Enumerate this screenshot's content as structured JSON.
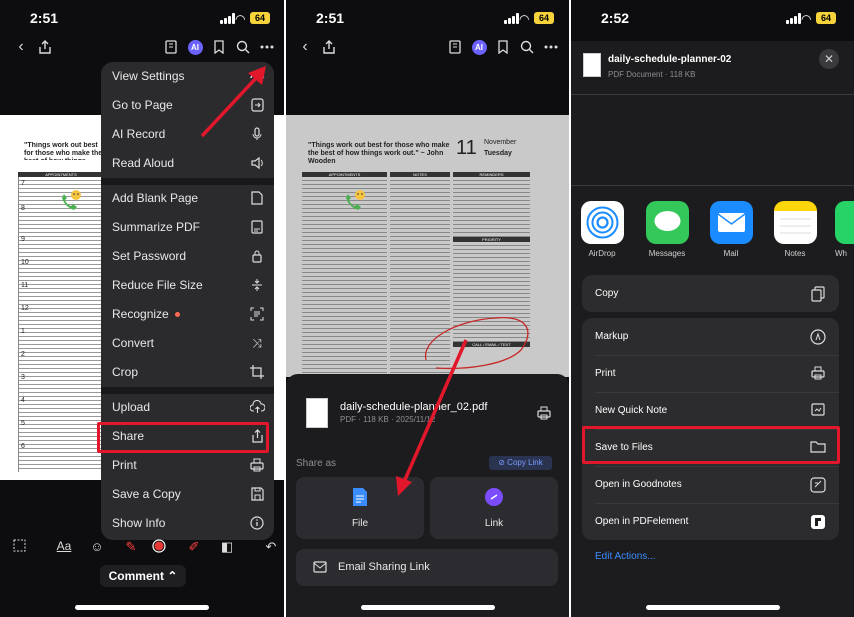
{
  "panel1": {
    "time": "2:51",
    "battery": "64",
    "document": {
      "quote": "\"Things work out best for those who make the best of how things work out.\" ~ John Wooden",
      "appointments_header": "APPOINTMENTS",
      "hours": [
        "7",
        "8",
        "9",
        "10",
        "11",
        "12",
        "1",
        "2",
        "3",
        "4",
        "5",
        "6"
      ]
    },
    "menu": {
      "items": [
        {
          "label": "View Settings",
          "icon": "text-size-icon"
        },
        {
          "label": "Go to Page",
          "icon": "goto-page-icon"
        },
        {
          "label": "AI Record",
          "icon": "microphone-icon"
        },
        {
          "label": "Read Aloud",
          "icon": "speaker-icon"
        },
        {
          "label": "Add Blank Page",
          "icon": "blank-page-icon"
        },
        {
          "label": "Summarize PDF",
          "icon": "summarize-icon"
        },
        {
          "label": "Set Password",
          "icon": "lock-icon"
        },
        {
          "label": "Reduce File Size",
          "icon": "compress-icon"
        },
        {
          "label": "Recognize",
          "icon": "ocr-icon"
        },
        {
          "label": "Convert",
          "icon": "shuffle-icon"
        },
        {
          "label": "Crop",
          "icon": "crop-icon"
        },
        {
          "label": "Upload",
          "icon": "cloud-upload-icon"
        },
        {
          "label": "Share",
          "icon": "share-icon"
        },
        {
          "label": "Print",
          "icon": "printer-icon"
        },
        {
          "label": "Save a Copy",
          "icon": "save-icon"
        },
        {
          "label": "Show Info",
          "icon": "info-icon"
        }
      ]
    },
    "comment_label": "Comment"
  },
  "panel2": {
    "time": "2:51",
    "battery": "64",
    "document": {
      "quote": "\"Things work out best for those who make the best of how things work out.\" ~ John Wooden",
      "day_number": "11",
      "month": "November",
      "weekday": "Tuesday",
      "headers": [
        "APPOINTMENTS",
        "NOTES",
        "REMINDERS"
      ],
      "priority": "PRIORITY",
      "call_header": "CALL / EMAIL / TEXT"
    },
    "share_sheet": {
      "file_name": "daily-schedule-planner_02.pdf",
      "file_meta": "PDF · 118 KB · 2025/11/12",
      "share_as": "Share as",
      "copy_link": "Copy Link",
      "file_label": "File",
      "link_label": "Link",
      "email_label": "Email Sharing Link"
    }
  },
  "panel3": {
    "time": "2:52",
    "battery": "64",
    "file_name": "daily-schedule-planner-02",
    "file_meta": "PDF Document · 118 KB",
    "apps": [
      {
        "label": "AirDrop",
        "color": "#ffffff"
      },
      {
        "label": "Messages",
        "color": "#34c759"
      },
      {
        "label": "Mail",
        "color": "#1a8cff"
      },
      {
        "label": "Notes",
        "color": "#ffd60a"
      },
      {
        "label": "Wh",
        "color": "#25d366"
      }
    ],
    "copy_label": "Copy",
    "actions": [
      {
        "label": "Markup",
        "icon": "markup-icon"
      },
      {
        "label": "Print",
        "icon": "printer-icon"
      },
      {
        "label": "New Quick Note",
        "icon": "quick-note-icon"
      },
      {
        "label": "Save to Files",
        "icon": "folder-icon"
      },
      {
        "label": "Open in Goodnotes",
        "icon": "goodnotes-icon"
      },
      {
        "label": "Open in PDFelement",
        "icon": "pdfelement-icon"
      }
    ],
    "edit_actions": "Edit Actions..."
  },
  "colors": {
    "highlight": "#e2172b",
    "annotation_arrow": "#e2172b",
    "accent_blue": "#3b8cff"
  }
}
